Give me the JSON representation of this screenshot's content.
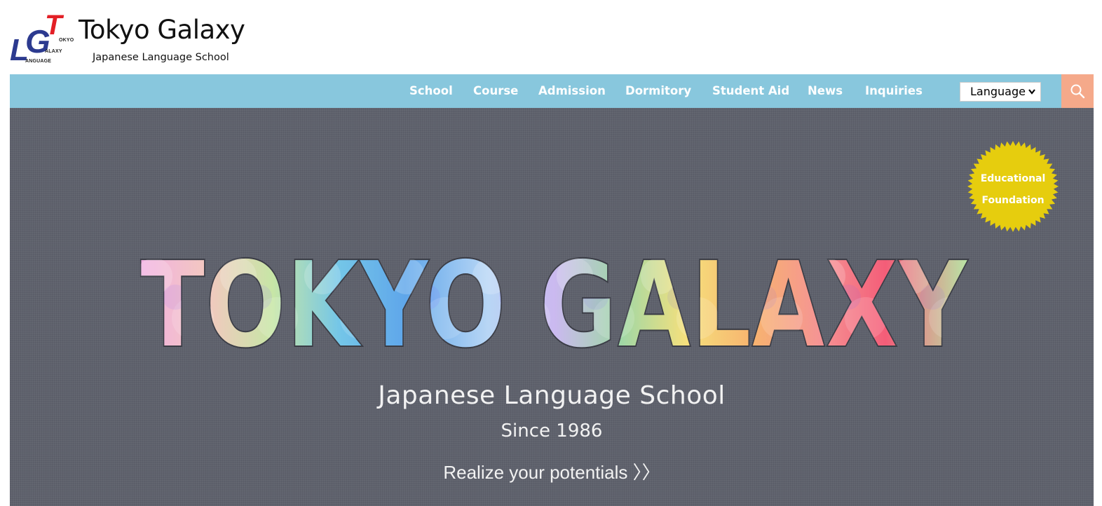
{
  "header": {
    "logo_letters": {
      "t": "T",
      "g": "G",
      "l": "L",
      "okyo": "OKYO",
      "alaxy": "ALAXY",
      "anguage": "ANGUAGE"
    },
    "title": "Tokyo Galaxy",
    "subtitle": "Japanese Language School"
  },
  "nav": {
    "items": [
      "School",
      "Course",
      "Admission",
      "Dormitory",
      "Student Aid",
      "News",
      "Inquiries"
    ],
    "language_select": "Language",
    "search_icon": "search-icon",
    "bar_color": "#88c7dd",
    "search_color": "#f5a98a"
  },
  "hero": {
    "badge_line1": "Educational",
    "badge_line2": "Foundation",
    "big_title": "TOKYO GALAXY",
    "tagline": "Japanese Language School",
    "since": "Since 1986",
    "cta": "Realize your potentials 〉〉",
    "badge_color": "#e6cd0e",
    "bg_color": "#5f626d"
  }
}
